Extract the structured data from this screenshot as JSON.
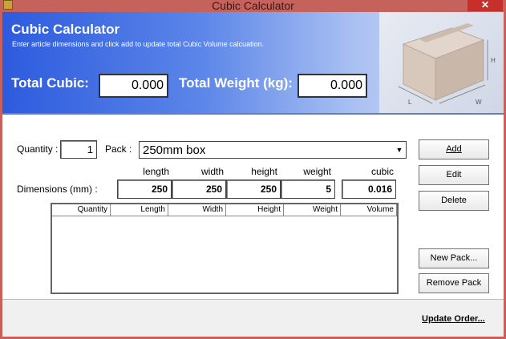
{
  "window": {
    "title": "Cubic Calculator",
    "close_glyph": "✕"
  },
  "banner": {
    "title": "Cubic Calculator",
    "subtitle": "Enter article dimensions and click add to update total Cubic Volume calcuation.",
    "total_cubic_label": "Total Cubic:",
    "total_cubic_value": "0.000",
    "total_weight_label": "Total Weight (kg):",
    "total_weight_value": "0.000",
    "box_letters": {
      "h": "H",
      "w": "W",
      "l": "L"
    }
  },
  "form": {
    "quantity_label": "Quantity :",
    "quantity_value": "1",
    "pack_label": "Pack :",
    "pack_value": "250mm box",
    "dimensions_label": "Dimensions (mm) :",
    "headers": {
      "length": "length",
      "width": "width",
      "height": "height",
      "weight": "weight",
      "cubic": "cubic"
    },
    "values": {
      "length": "250",
      "width": "250",
      "height": "250",
      "weight": "5",
      "cubic": "0.016"
    }
  },
  "list": {
    "columns": [
      "Quantity",
      "Length",
      "Width",
      "Height",
      "Weight",
      "Volume"
    ]
  },
  "buttons": {
    "add": "Add",
    "edit": "Edit",
    "delete": "Delete",
    "new_pack": "New Pack...",
    "remove_pack": "Remove Pack"
  },
  "footer": {
    "update_order": "Update Order..."
  }
}
